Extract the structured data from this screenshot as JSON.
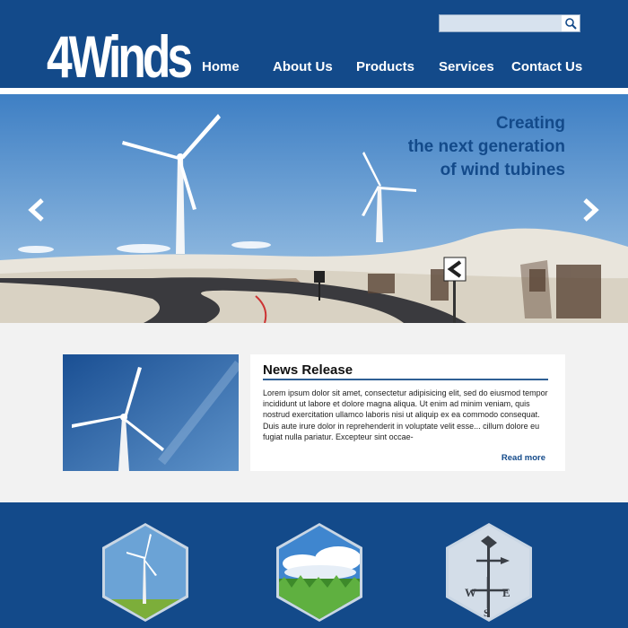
{
  "brand": {
    "logo_text": "4Winds"
  },
  "search": {
    "placeholder": "",
    "icon": "search-icon"
  },
  "nav": {
    "items": [
      "Home",
      "About Us",
      "Products",
      "Services",
      "Contact Us"
    ]
  },
  "hero": {
    "headline": [
      "Creating",
      "the next generation",
      "of wind tubines"
    ],
    "prev_icon": "chevron-left-icon",
    "next_icon": "chevron-right-icon"
  },
  "news": {
    "title": "News Release",
    "body": "Lorem ipsum dolor sit amet, consectetur adipisicing elit, sed do eiusmod tempor incididunt ut labore et dolore magna aliqua. Ut enim ad minim veniam, quis nostrud exercitation ullamco laboris nisi ut aliquip ex ea commodo consequat. Duis aute irure dolor in reprehenderit in voluptate velit esse... cillum dolore eu fugiat nulla pariatur. Excepteur sint occae-",
    "read_more": "Read more"
  },
  "colors": {
    "brand": "#134a8a",
    "sky": "#5b9bd5",
    "panel": "#ffffff"
  }
}
